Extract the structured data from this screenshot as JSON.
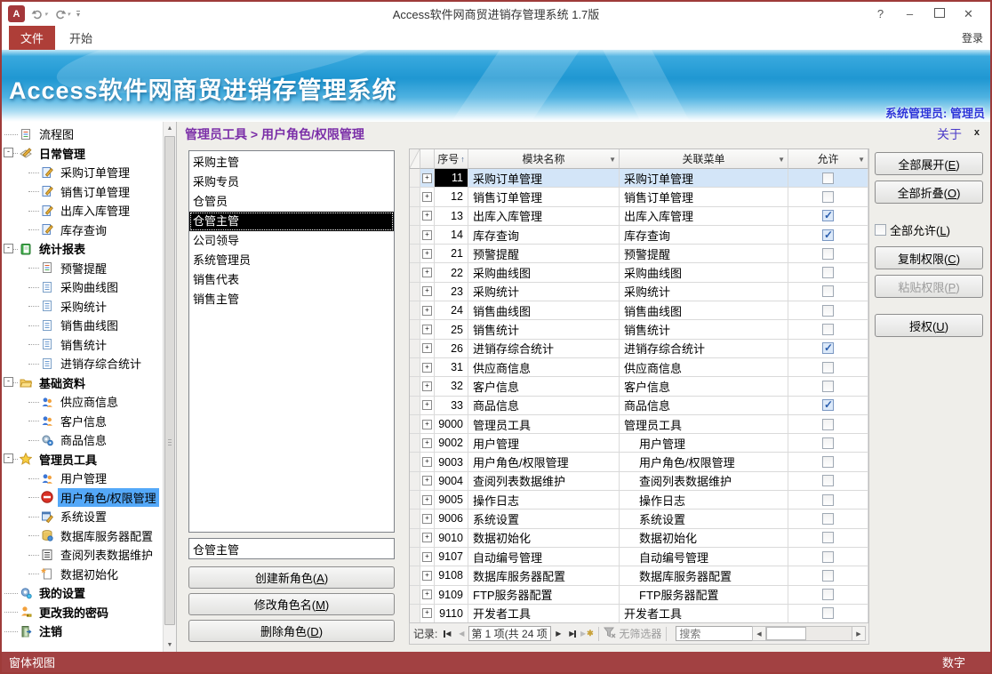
{
  "window": {
    "title": "Access软件网商贸进销存管理系统 1.7版",
    "help": "?",
    "minimize": "–",
    "close": "✕"
  },
  "ribbon": {
    "file_tab": "文件",
    "home_tab": "开始",
    "login": "登录"
  },
  "banner": {
    "title": "Access软件网商贸进销存管理系统",
    "user": "系统管理员: 管理员"
  },
  "content_header": {
    "breadcrumb": "管理员工具 > 用户角色/权限管理",
    "about": "关于",
    "close": "x"
  },
  "colors": {
    "window_border": "#9e3b39",
    "file_tab": "#ae3e38",
    "status_bar": "#a24142",
    "banner_blue": "#1f97d2",
    "breadcrumb": "#7b2fa8",
    "tree_selection": "#54a8f8",
    "row_selection": "#d3e5f8",
    "check_mark": "#2b5eae"
  },
  "sidebar": {
    "items": [
      {
        "label": "流程图",
        "icon": "doc-lines",
        "level": 0,
        "bold": false
      },
      {
        "label": "日常管理",
        "icon": "pencil-note",
        "level": 0,
        "bold": true,
        "expander": "-"
      },
      {
        "label": "采购订单管理",
        "icon": "edit-doc",
        "level": 1
      },
      {
        "label": "销售订单管理",
        "icon": "edit-doc",
        "level": 1
      },
      {
        "label": "出库入库管理",
        "icon": "edit-doc",
        "level": 1
      },
      {
        "label": "库存查询",
        "icon": "edit-doc",
        "level": 1
      },
      {
        "label": "统计报表",
        "icon": "green-book",
        "level": 0,
        "bold": true,
        "expander": "-"
      },
      {
        "label": "预警提醒",
        "icon": "doc-lines",
        "level": 1
      },
      {
        "label": "采购曲线图",
        "icon": "report-doc",
        "level": 1
      },
      {
        "label": "采购统计",
        "icon": "report-doc",
        "level": 1
      },
      {
        "label": "销售曲线图",
        "icon": "report-doc",
        "level": 1
      },
      {
        "label": "销售统计",
        "icon": "report-doc",
        "level": 1
      },
      {
        "label": "进销存综合统计",
        "icon": "report-doc",
        "level": 1
      },
      {
        "label": "基础资料",
        "icon": "folder",
        "level": 0,
        "bold": true,
        "expander": "-"
      },
      {
        "label": "供应商信息",
        "icon": "users",
        "level": 1
      },
      {
        "label": "客户信息",
        "icon": "users",
        "level": 1
      },
      {
        "label": "商品信息",
        "icon": "gears",
        "level": 1
      },
      {
        "label": "管理员工具",
        "icon": "star",
        "level": 0,
        "bold": true,
        "expander": "-"
      },
      {
        "label": "用户管理",
        "icon": "users",
        "level": 1
      },
      {
        "label": "用户角色/权限管理",
        "icon": "no-entry",
        "level": 1,
        "selected": true
      },
      {
        "label": "系统设置",
        "icon": "window-pencil",
        "level": 1
      },
      {
        "label": "数据库服务器配置",
        "icon": "database",
        "level": 1
      },
      {
        "label": "查阅列表数据维护",
        "icon": "list",
        "level": 1
      },
      {
        "label": "数据初始化",
        "icon": "new-page",
        "level": 1
      },
      {
        "label": "我的设置",
        "icon": "gear",
        "level": 0,
        "bold": true
      },
      {
        "label": "更改我的密码",
        "icon": "user-key",
        "level": 0,
        "bold": true
      },
      {
        "label": "注销",
        "icon": "door",
        "level": 0,
        "bold": true
      }
    ]
  },
  "roles": {
    "items": [
      "采购主管",
      "采购专员",
      "仓管员",
      "仓管主管",
      "公司领导",
      "系统管理员",
      "销售代表",
      "销售主管"
    ],
    "selected_index": 3,
    "name_value": "仓管主管",
    "create": "创建新角色(A)",
    "rename": "修改角色名(M)",
    "delete": "删除角色(D)"
  },
  "table": {
    "columns": [
      {
        "key": "seq",
        "label": "序号",
        "sort": "asc"
      },
      {
        "key": "module",
        "label": "模块名称"
      },
      {
        "key": "menu",
        "label": "关联菜单"
      },
      {
        "key": "allow",
        "label": "允许"
      }
    ],
    "rows": [
      {
        "seq": "11",
        "module": "采购订单管理",
        "menu": "采购订单管理",
        "indent": false,
        "allowed": false,
        "selected": true
      },
      {
        "seq": "12",
        "module": "销售订单管理",
        "menu": "销售订单管理",
        "indent": false,
        "allowed": false
      },
      {
        "seq": "13",
        "module": "出库入库管理",
        "menu": "出库入库管理",
        "indent": false,
        "allowed": true
      },
      {
        "seq": "14",
        "module": "库存查询",
        "menu": "库存查询",
        "indent": false,
        "allowed": true
      },
      {
        "seq": "21",
        "module": "预警提醒",
        "menu": "预警提醒",
        "indent": false,
        "allowed": false
      },
      {
        "seq": "22",
        "module": "采购曲线图",
        "menu": "采购曲线图",
        "indent": false,
        "allowed": false
      },
      {
        "seq": "23",
        "module": "采购统计",
        "menu": "采购统计",
        "indent": false,
        "allowed": false
      },
      {
        "seq": "24",
        "module": "销售曲线图",
        "menu": "销售曲线图",
        "indent": false,
        "allowed": false
      },
      {
        "seq": "25",
        "module": "销售统计",
        "menu": "销售统计",
        "indent": false,
        "allowed": false
      },
      {
        "seq": "26",
        "module": "进销存综合统计",
        "menu": "进销存综合统计",
        "indent": false,
        "allowed": true
      },
      {
        "seq": "31",
        "module": "供应商信息",
        "menu": "供应商信息",
        "indent": false,
        "allowed": false
      },
      {
        "seq": "32",
        "module": "客户信息",
        "menu": "客户信息",
        "indent": false,
        "allowed": false
      },
      {
        "seq": "33",
        "module": "商品信息",
        "menu": "商品信息",
        "indent": false,
        "allowed": true
      },
      {
        "seq": "9000",
        "module": "管理员工具",
        "menu": "管理员工具",
        "indent": false,
        "allowed": false
      },
      {
        "seq": "9002",
        "module": "用户管理",
        "menu": "用户管理",
        "indent": true,
        "allowed": false
      },
      {
        "seq": "9003",
        "module": "用户角色/权限管理",
        "menu": "用户角色/权限管理",
        "indent": true,
        "allowed": false
      },
      {
        "seq": "9004",
        "module": "查阅列表数据维护",
        "menu": "查阅列表数据维护",
        "indent": true,
        "allowed": false
      },
      {
        "seq": "9005",
        "module": "操作日志",
        "menu": "操作日志",
        "indent": true,
        "allowed": false
      },
      {
        "seq": "9006",
        "module": "系统设置",
        "menu": "系统设置",
        "indent": true,
        "allowed": false
      },
      {
        "seq": "9010",
        "module": "数据初始化",
        "menu": "数据初始化",
        "indent": true,
        "allowed": false
      },
      {
        "seq": "9107",
        "module": "自动编号管理",
        "menu": "自动编号管理",
        "indent": true,
        "allowed": false
      },
      {
        "seq": "9108",
        "module": "数据库服务器配置",
        "menu": "数据库服务器配置",
        "indent": true,
        "allowed": false
      },
      {
        "seq": "9109",
        "module": "FTP服务器配置",
        "menu": "FTP服务器配置",
        "indent": true,
        "allowed": false
      },
      {
        "seq": "9110",
        "module": "开发者工具",
        "menu": "开发者工具",
        "indent": false,
        "allowed": false
      }
    ]
  },
  "record_nav": {
    "label": "记录:",
    "position": "第 1 项(共 24 项",
    "filter": "无筛选器",
    "search": "搜索"
  },
  "right_panel": {
    "expand_all": "全部展开(E)",
    "collapse_all": "全部折叠(O)",
    "allow_all": "全部允许(L)",
    "copy": "复制权限(C)",
    "paste": "粘贴权限(P)",
    "authorize": "授权(U)"
  },
  "status_bar": {
    "left": "窗体视图",
    "right": "数字"
  }
}
